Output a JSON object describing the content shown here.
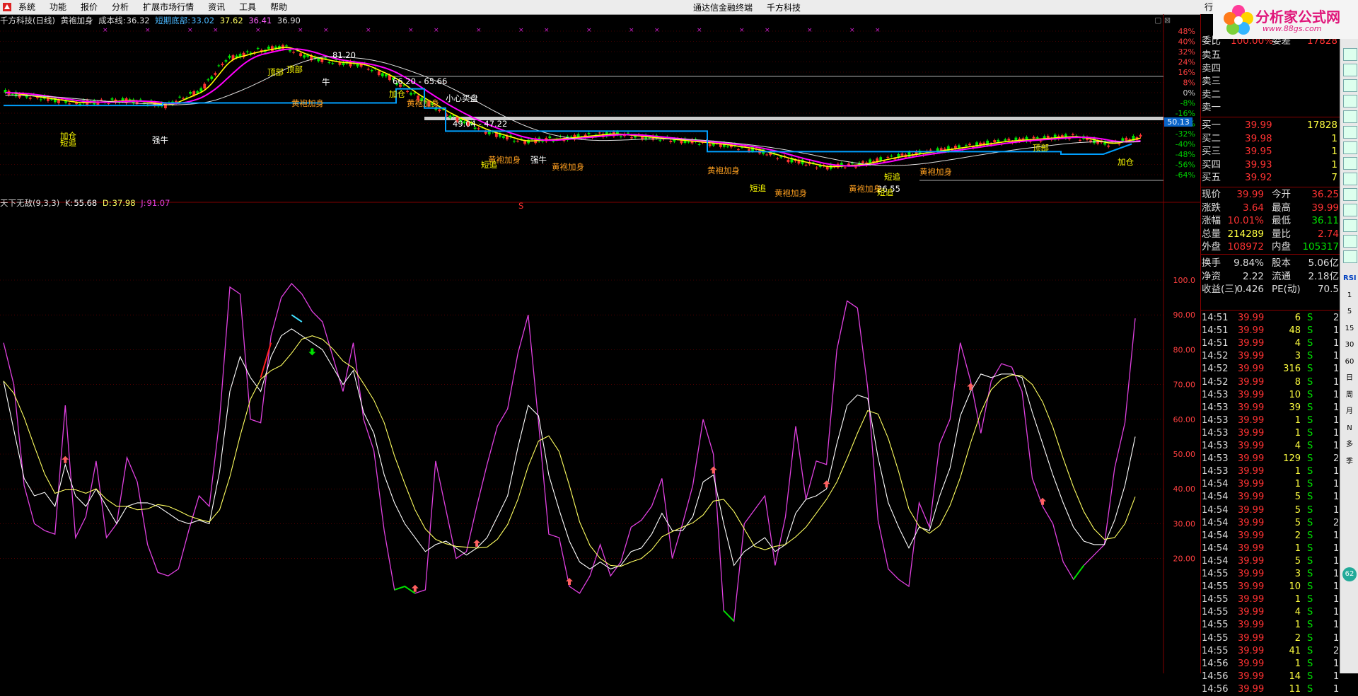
{
  "menu": {
    "items": [
      "系统",
      "功能",
      "报价",
      "分析",
      "扩展市场行情",
      "资讯",
      "工具",
      "帮助"
    ],
    "center": [
      "通达信金融终端",
      "千方科技"
    ],
    "right_tab": "行"
  },
  "logo": {
    "title": "分析家公式网",
    "url": "www.88gs.com"
  },
  "main_info": {
    "name": "千方科技(日线)",
    "indicator": "黄袍加身",
    "cost_label": "成本线:",
    "cost_value": "36.32",
    "short_label": "短期底部:",
    "short_value": "33.02",
    "v2": "37.62",
    "v3": "36.41",
    "v4": "36.90"
  },
  "sub_info": {
    "name": "天下无敌(9,3,3)",
    "k_label": "K:",
    "k_value": "55.68",
    "d_label": "D:",
    "d_value": "37.98",
    "j_label": "J:",
    "j_value": "91.07"
  },
  "price_axis": [
    "48%",
    "40%",
    "32%",
    "24%",
    "16%",
    "8%",
    "0%",
    "-8%",
    "-16%",
    "-24%",
    "-32%",
    "-40%",
    "-48%",
    "-56%",
    "-64%"
  ],
  "current_price_tag": "50.13",
  "kdj_axis": [
    "100.0",
    "90.00",
    "80.00",
    "70.00",
    "60.00",
    "50.00",
    "40.00",
    "30.00",
    "20.00"
  ],
  "price_labels": [
    {
      "text": "81.20"
    },
    {
      "text": "66.20 - 65.66"
    },
    {
      "text": "49.04 - 47.22"
    },
    {
      "text": "26.55"
    },
    {
      "text": "小心买盘"
    },
    {
      "text": "顶部"
    },
    {
      "text": "顶部"
    },
    {
      "text": "顶部"
    },
    {
      "text": "黄袍加身"
    },
    {
      "text": "黄袍加身"
    },
    {
      "text": "黄袍加身"
    },
    {
      "text": "黄袍加身"
    },
    {
      "text": "黄袍加身"
    },
    {
      "text": "黄袍加身"
    },
    {
      "text": "黄袍加身"
    },
    {
      "text": "黄袍加身"
    },
    {
      "text": "加仓"
    },
    {
      "text": "加仓"
    },
    {
      "text": "加仓"
    },
    {
      "text": "短追"
    },
    {
      "text": "短追"
    },
    {
      "text": "短追"
    },
    {
      "text": "短追"
    },
    {
      "text": "短追"
    },
    {
      "text": "强牛"
    },
    {
      "text": "强牛"
    },
    {
      "text": "牛"
    },
    {
      "text": "S"
    }
  ],
  "order_book": {
    "committee_ratio_label": "委比",
    "committee_ratio_value": "100.00%",
    "committee_diff_label": "委差",
    "committee_diff_value": "17828",
    "sells": [
      {
        "label": "卖五",
        "price": "",
        "vol": ""
      },
      {
        "label": "卖四",
        "price": "",
        "vol": ""
      },
      {
        "label": "卖三",
        "price": "",
        "vol": ""
      },
      {
        "label": "卖二",
        "price": "",
        "vol": ""
      },
      {
        "label": "卖一",
        "price": "",
        "vol": ""
      }
    ],
    "buys": [
      {
        "label": "买一",
        "price": "39.99",
        "vol": "17828"
      },
      {
        "label": "买二",
        "price": "39.98",
        "vol": "1"
      },
      {
        "label": "买三",
        "price": "39.95",
        "vol": "1"
      },
      {
        "label": "买四",
        "price": "39.93",
        "vol": "1"
      },
      {
        "label": "买五",
        "price": "39.92",
        "vol": "7"
      }
    ]
  },
  "stats": [
    {
      "l1": "现价",
      "v1": "39.99",
      "l2": "今开",
      "v2": "36.25"
    },
    {
      "l1": "涨跌",
      "v1": "3.64",
      "l2": "最高",
      "v2": "39.99"
    },
    {
      "l1": "涨幅",
      "v1": "10.01%",
      "l2": "最低",
      "v2": "36.11"
    },
    {
      "l1": "总量",
      "v1": "214289",
      "l2": "量比",
      "v2": "2.74"
    },
    {
      "l1": "外盘",
      "v1": "108972",
      "l2": "内盘",
      "v2": "105317"
    },
    {
      "l1": "换手",
      "v1": "9.84%",
      "l2": "股本",
      "v2": "5.06亿"
    },
    {
      "l1": "净资",
      "v1": "2.22",
      "l2": "流通",
      "v2": "2.18亿"
    },
    {
      "l1": "收益(三)",
      "v1": "0.426",
      "l2": "PE(动)",
      "v2": "70.5"
    }
  ],
  "ticks": [
    [
      "14:51",
      "39.99",
      "6",
      "S",
      "2"
    ],
    [
      "14:51",
      "39.99",
      "48",
      "S",
      "1"
    ],
    [
      "14:51",
      "39.99",
      "4",
      "S",
      "1"
    ],
    [
      "14:52",
      "39.99",
      "3",
      "S",
      "1"
    ],
    [
      "14:52",
      "39.99",
      "316",
      "S",
      "1"
    ],
    [
      "14:52",
      "39.99",
      "8",
      "S",
      "1"
    ],
    [
      "14:53",
      "39.99",
      "10",
      "S",
      "1"
    ],
    [
      "14:53",
      "39.99",
      "39",
      "S",
      "1"
    ],
    [
      "14:53",
      "39.99",
      "1",
      "S",
      "1"
    ],
    [
      "14:53",
      "39.99",
      "1",
      "S",
      "1"
    ],
    [
      "14:53",
      "39.99",
      "4",
      "S",
      "1"
    ],
    [
      "14:53",
      "39.99",
      "129",
      "S",
      "2"
    ],
    [
      "14:53",
      "39.99",
      "1",
      "S",
      "1"
    ],
    [
      "14:54",
      "39.99",
      "1",
      "S",
      "1"
    ],
    [
      "14:54",
      "39.99",
      "5",
      "S",
      "1"
    ],
    [
      "14:54",
      "39.99",
      "5",
      "S",
      "1"
    ],
    [
      "14:54",
      "39.99",
      "5",
      "S",
      "2"
    ],
    [
      "14:54",
      "39.99",
      "2",
      "S",
      "1"
    ],
    [
      "14:54",
      "39.99",
      "1",
      "S",
      "1"
    ],
    [
      "14:54",
      "39.99",
      "5",
      "S",
      "1"
    ],
    [
      "14:55",
      "39.99",
      "3",
      "S",
      "1"
    ],
    [
      "14:55",
      "39.99",
      "10",
      "S",
      "1"
    ],
    [
      "14:55",
      "39.99",
      "1",
      "S",
      "1"
    ],
    [
      "14:55",
      "39.99",
      "4",
      "S",
      "1"
    ],
    [
      "14:55",
      "39.99",
      "1",
      "S",
      "1"
    ],
    [
      "14:55",
      "39.99",
      "2",
      "S",
      "1"
    ],
    [
      "14:55",
      "39.99",
      "41",
      "S",
      "2"
    ],
    [
      "14:56",
      "39.99",
      "1",
      "S",
      "1"
    ],
    [
      "14:56",
      "39.99",
      "14",
      "S",
      "1"
    ],
    [
      "14:56",
      "39.99",
      "11",
      "S",
      "1"
    ]
  ],
  "toolbar": [
    "RSI",
    "1",
    "5",
    "15",
    "30",
    "60",
    "日",
    "周",
    "月",
    "N",
    "多",
    "季"
  ],
  "badge": "62",
  "colors": {
    "up": "#ff3232",
    "down": "#00e600",
    "ma_white": "#dddddd",
    "ma_yellow": "#ffff00",
    "ma_magenta": "#ff00ff",
    "support": "#00a0ff",
    "k": "#ffffff",
    "d": "#ffff60",
    "j": "#e040e0",
    "grid": "#800000"
  },
  "kdj_data": {
    "j": [
      82,
      70,
      41,
      30,
      28,
      27,
      64,
      26,
      32,
      48,
      26,
      30,
      49,
      42,
      24,
      16,
      15,
      17,
      28,
      38,
      35,
      60,
      98,
      96,
      60,
      59,
      84,
      95,
      99,
      96,
      91,
      88,
      78,
      68,
      82,
      60,
      51,
      28,
      11,
      12,
      10,
      11,
      48,
      34,
      20,
      22,
      35,
      47,
      58,
      63,
      79,
      90,
      59,
      27,
      26,
      12,
      10,
      15,
      24,
      15,
      19,
      29,
      31,
      35,
      43,
      20,
      30,
      41,
      60,
      50,
      5,
      2,
      30,
      34,
      38,
      18,
      32,
      58,
      37,
      48,
      47,
      80,
      94,
      92,
      69,
      31,
      17,
      14,
      12,
      36,
      29,
      53,
      60,
      82,
      71,
      56,
      71,
      76,
      75,
      68,
      43,
      35,
      30,
      19,
      14,
      18,
      21,
      24,
      46,
      59,
      89
    ],
    "k": [
      71,
      57,
      43,
      38,
      39,
      35,
      47,
      38,
      35,
      40,
      35,
      30,
      35,
      36,
      36,
      35,
      33,
      31,
      30,
      31,
      30,
      45,
      68,
      78,
      72,
      68,
      78,
      84,
      86,
      84,
      82,
      80,
      75,
      70,
      74,
      62,
      56,
      44,
      36,
      30,
      26,
      22,
      24,
      25,
      23,
      21,
      23,
      26,
      32,
      38,
      52,
      64,
      61,
      44,
      34,
      25,
      19,
      17,
      19,
      17,
      18,
      22,
      23,
      27,
      33,
      28,
      28,
      32,
      42,
      44,
      30,
      18,
      22,
      24,
      26,
      22,
      24,
      33,
      37,
      38,
      40,
      53,
      64,
      67,
      66,
      49,
      36,
      29,
      23,
      29,
      28,
      38,
      46,
      61,
      68,
      73,
      72,
      73,
      73,
      72,
      62,
      53,
      44,
      36,
      29,
      25,
      24,
      24,
      31,
      41,
      55
    ]
  }
}
